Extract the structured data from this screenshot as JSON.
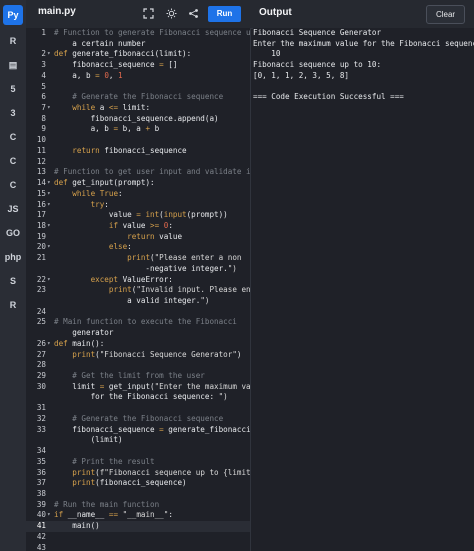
{
  "header": {
    "file_tab": "main.py",
    "run_label": "Run",
    "output_title": "Output",
    "clear_label": "Clear",
    "icons": [
      "fullscreen-icon",
      "theme-brightness-icon",
      "share-icon"
    ]
  },
  "sidebar": {
    "items": [
      {
        "name": "python",
        "label": "Py"
      },
      {
        "name": "r",
        "label": "R"
      },
      {
        "name": "sql",
        "label": "▤"
      },
      {
        "name": "html",
        "label": "5"
      },
      {
        "name": "css",
        "label": "3"
      },
      {
        "name": "c",
        "label": "C"
      },
      {
        "name": "cpp",
        "label": "C"
      },
      {
        "name": "csharp",
        "label": "C"
      },
      {
        "name": "javascript",
        "label": "JS"
      },
      {
        "name": "go",
        "label": "GO"
      },
      {
        "name": "php",
        "label": "php"
      },
      {
        "name": "swift",
        "label": "S"
      },
      {
        "name": "rust",
        "label": "R"
      }
    ]
  },
  "editor": {
    "lines": [
      {
        "n": "1",
        "fold": false,
        "text": "# Function to generate Fibonacci sequence up to"
      },
      {
        "n": "",
        "fold": false,
        "text": "    a certain number"
      },
      {
        "n": "2",
        "fold": true,
        "text": "def generate_fibonacci(limit):"
      },
      {
        "n": "3",
        "fold": false,
        "text": "    fibonacci_sequence = []"
      },
      {
        "n": "4",
        "fold": false,
        "text": "    a, b = 0, 1"
      },
      {
        "n": "5",
        "fold": false,
        "text": ""
      },
      {
        "n": "6",
        "fold": false,
        "text": "    # Generate the Fibonacci sequence"
      },
      {
        "n": "7",
        "fold": true,
        "text": "    while a <= limit:"
      },
      {
        "n": "8",
        "fold": false,
        "text": "        fibonacci_sequence.append(a)"
      },
      {
        "n": "9",
        "fold": false,
        "text": "        a, b = b, a + b"
      },
      {
        "n": "10",
        "fold": false,
        "text": ""
      },
      {
        "n": "11",
        "fold": false,
        "text": "    return fibonacci_sequence"
      },
      {
        "n": "12",
        "fold": false,
        "text": ""
      },
      {
        "n": "13",
        "fold": false,
        "text": "# Function to get user input and validate it"
      },
      {
        "n": "14",
        "fold": true,
        "text": "def get_input(prompt):"
      },
      {
        "n": "15",
        "fold": true,
        "text": "    while True:"
      },
      {
        "n": "16",
        "fold": true,
        "text": "        try:"
      },
      {
        "n": "17",
        "fold": false,
        "text": "            value = int(input(prompt))"
      },
      {
        "n": "18",
        "fold": true,
        "text": "            if value >= 0:"
      },
      {
        "n": "19",
        "fold": false,
        "text": "                return value"
      },
      {
        "n": "20",
        "fold": true,
        "text": "            else:"
      },
      {
        "n": "21",
        "fold": false,
        "text": "                print(\"Please enter a non"
      },
      {
        "n": "",
        "fold": false,
        "text": "                    -negative integer.\")"
      },
      {
        "n": "22",
        "fold": true,
        "text": "        except ValueError:"
      },
      {
        "n": "23",
        "fold": false,
        "text": "            print(\"Invalid input. Please enter"
      },
      {
        "n": "",
        "fold": false,
        "text": "                a valid integer.\")"
      },
      {
        "n": "24",
        "fold": false,
        "text": ""
      },
      {
        "n": "25",
        "fold": false,
        "text": "# Main function to execute the Fibonacci"
      },
      {
        "n": "",
        "fold": false,
        "text": "    generator"
      },
      {
        "n": "26",
        "fold": true,
        "text": "def main():"
      },
      {
        "n": "27",
        "fold": false,
        "text": "    print(\"Fibonacci Sequence Generator\")"
      },
      {
        "n": "28",
        "fold": false,
        "text": ""
      },
      {
        "n": "29",
        "fold": false,
        "text": "    # Get the limit from the user"
      },
      {
        "n": "30",
        "fold": false,
        "text": "    limit = get_input(\"Enter the maximum value"
      },
      {
        "n": "",
        "fold": false,
        "text": "        for the Fibonacci sequence: \")"
      },
      {
        "n": "31",
        "fold": false,
        "text": ""
      },
      {
        "n": "32",
        "fold": false,
        "text": "    # Generate the Fibonacci sequence"
      },
      {
        "n": "33",
        "fold": false,
        "text": "    fibonacci_sequence = generate_fibonacci"
      },
      {
        "n": "",
        "fold": false,
        "text": "        (limit)"
      },
      {
        "n": "34",
        "fold": false,
        "text": ""
      },
      {
        "n": "35",
        "fold": false,
        "text": "    # Print the result"
      },
      {
        "n": "36",
        "fold": false,
        "text": "    print(f\"Fibonacci sequence up to {limit}:\")"
      },
      {
        "n": "37",
        "fold": false,
        "text": "    print(fibonacci_sequence)"
      },
      {
        "n": "38",
        "fold": false,
        "text": ""
      },
      {
        "n": "39",
        "fold": false,
        "text": "# Run the main function"
      },
      {
        "n": "40",
        "fold": true,
        "text": "if __name__ == \"__main__\":"
      },
      {
        "n": "41",
        "fold": false,
        "text": "    main()"
      },
      {
        "n": "42",
        "fold": false,
        "text": ""
      },
      {
        "n": "43",
        "fold": false,
        "text": ""
      }
    ],
    "active_line": "41"
  },
  "output": {
    "lines": [
      "Fibonacci Sequence Generator",
      "Enter the maximum value for the Fibonacci sequence:",
      "    10",
      "Fibonacci sequence up to 10:",
      "[0, 1, 1, 2, 3, 5, 8]",
      "",
      "=== Code Execution Successful ==="
    ]
  },
  "colors": {
    "accent": "#1e73e8",
    "keyword": "#d6a14c",
    "comment": "#7b8088",
    "number": "#e0694d",
    "background": "#1f2128"
  }
}
